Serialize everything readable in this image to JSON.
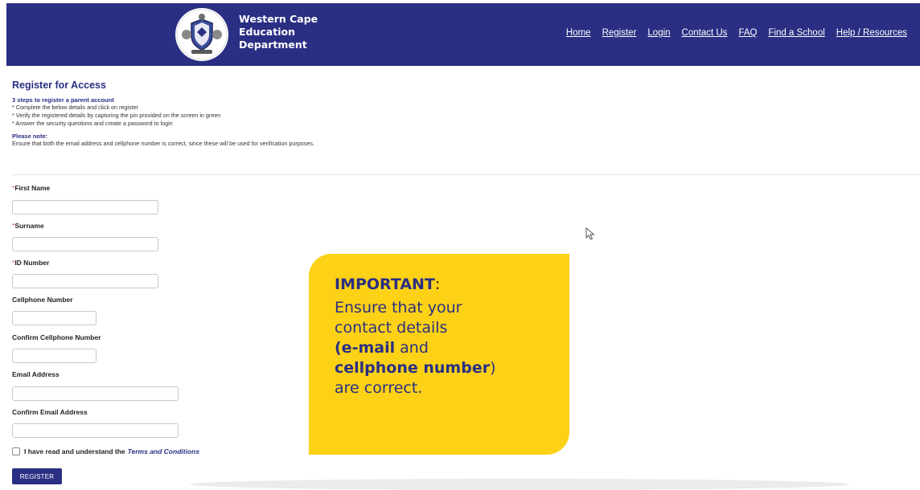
{
  "header": {
    "brand_lines": [
      "Western Cape",
      "Education",
      "Department"
    ],
    "logo_icon": "coat-of-arms-icon",
    "nav": [
      "Home",
      "Register",
      "Login",
      "Contact Us",
      "FAQ",
      "Find a School",
      "Help / Resources"
    ],
    "bg_color": "#2a2f83"
  },
  "intro": {
    "title": "Register for Access",
    "steps_title": "3 steps to register a parent account",
    "steps": [
      "* Complete the below details and click on register",
      "* Verify the registered details by capturing the pin provided on the screen in green",
      "* Answer the security questions and create a password to login"
    ],
    "note_title": "Please note:",
    "note_text": "Ensure that both the email address and cellphone number is correct, since these will be used for verification purposes."
  },
  "form": {
    "required_mark": "*",
    "fields": [
      {
        "label": "First Name",
        "required": true,
        "value": ""
      },
      {
        "label": "Surname",
        "required": true,
        "value": ""
      },
      {
        "label": "ID Number",
        "required": true,
        "value": ""
      },
      {
        "label": "Cellphone Number",
        "required": false,
        "value": ""
      },
      {
        "label": "Confirm Cellphone Number",
        "required": false,
        "value": ""
      },
      {
        "label": "Email Address",
        "required": false,
        "value": ""
      },
      {
        "label": "Confirm Email Address",
        "required": false,
        "value": ""
      }
    ],
    "terms_text": "I have read and understand the",
    "terms_link": "Terms and Conditions",
    "terms_checked": false,
    "register_label": "REGISTER"
  },
  "callout": {
    "heading": "IMPORTANT",
    "colon": ":",
    "line1": "Ensure that your",
    "line2": "contact details",
    "line3_bold": "(e-mail",
    "line3_rest": " and",
    "line4_bold": "cellphone number",
    "line4_rest": ")",
    "line5": "are correct.",
    "bg_color": "#fcd116"
  }
}
